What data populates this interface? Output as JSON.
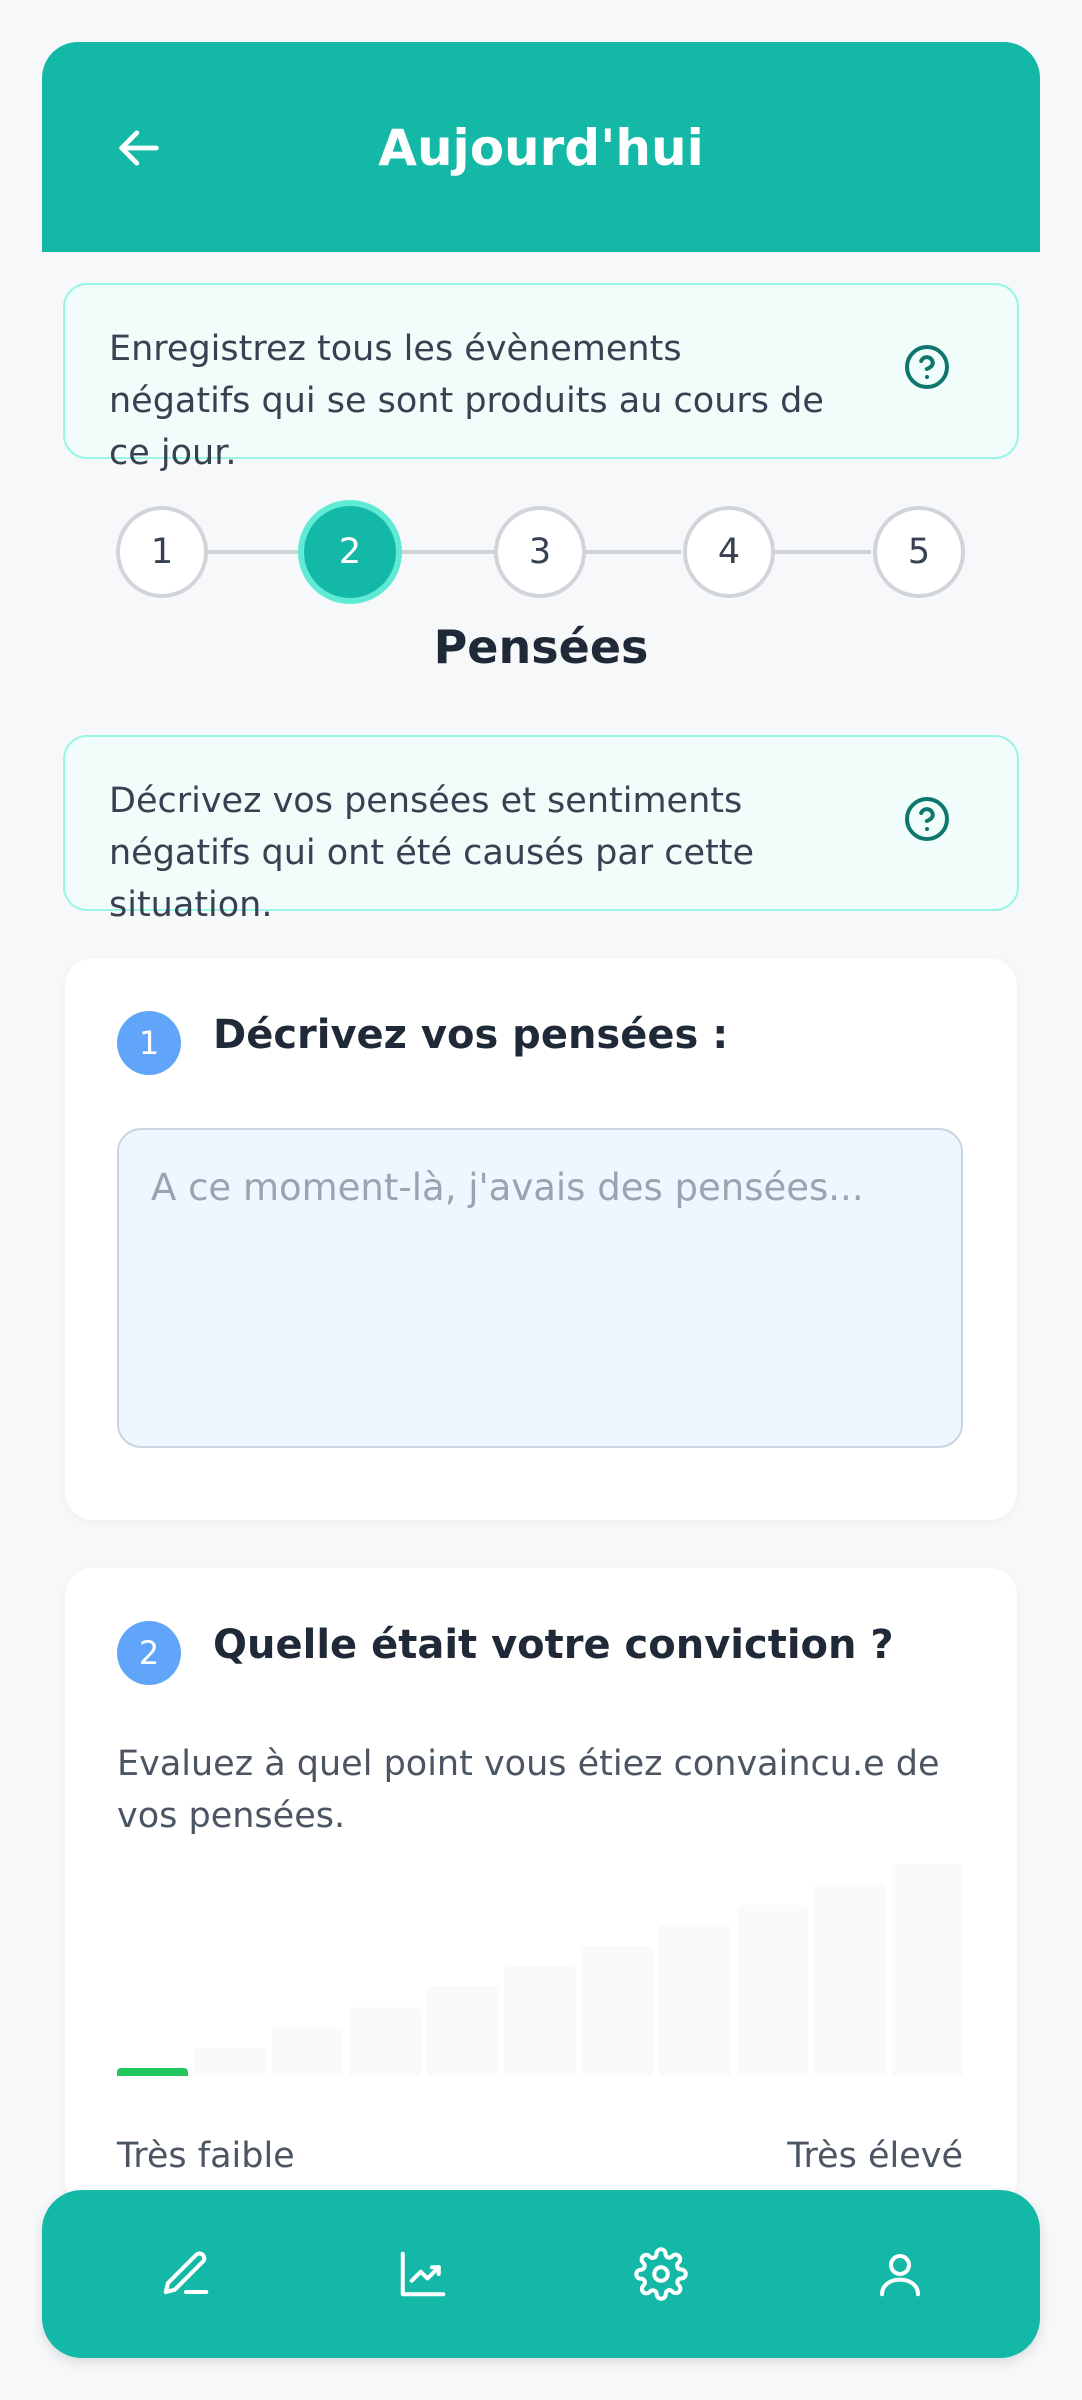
{
  "header": {
    "title": "Aujourd'hui",
    "back_icon": "arrow-left-icon"
  },
  "intro": {
    "text": "Enregistrez tous les évènements négatifs qui se sont produits au cours de ce jour."
  },
  "stepper": {
    "steps": [
      "1",
      "2",
      "3",
      "4",
      "5"
    ],
    "active_step": 2,
    "title": "Pensées"
  },
  "step_info": {
    "text": "Décrivez vos pensées et sentiments négatifs qui ont été causés par cette situation."
  },
  "question1": {
    "number": "1",
    "title": "Décrivez vos pensées :",
    "placeholder": "A ce moment-là, j'avais des pensées...",
    "value": ""
  },
  "question2": {
    "number": "2",
    "title": "Quelle était votre conviction ?",
    "description": "Evaluez à quel point vous étiez convaincu.e de vos pensées.",
    "scale": {
      "levels": 11,
      "selected_level": 1,
      "low_label": "Très faible",
      "high_label": "Très élevé"
    }
  },
  "bottom_nav": {
    "items": [
      "edit-icon",
      "chart-icon",
      "settings-icon",
      "profile-icon"
    ]
  },
  "colors": {
    "primary": "#14b8a6",
    "info_bg": "#f0fdfa",
    "info_border": "#99f6e4",
    "badge": "#60a5fa",
    "selected_bar": "#22c55e"
  }
}
